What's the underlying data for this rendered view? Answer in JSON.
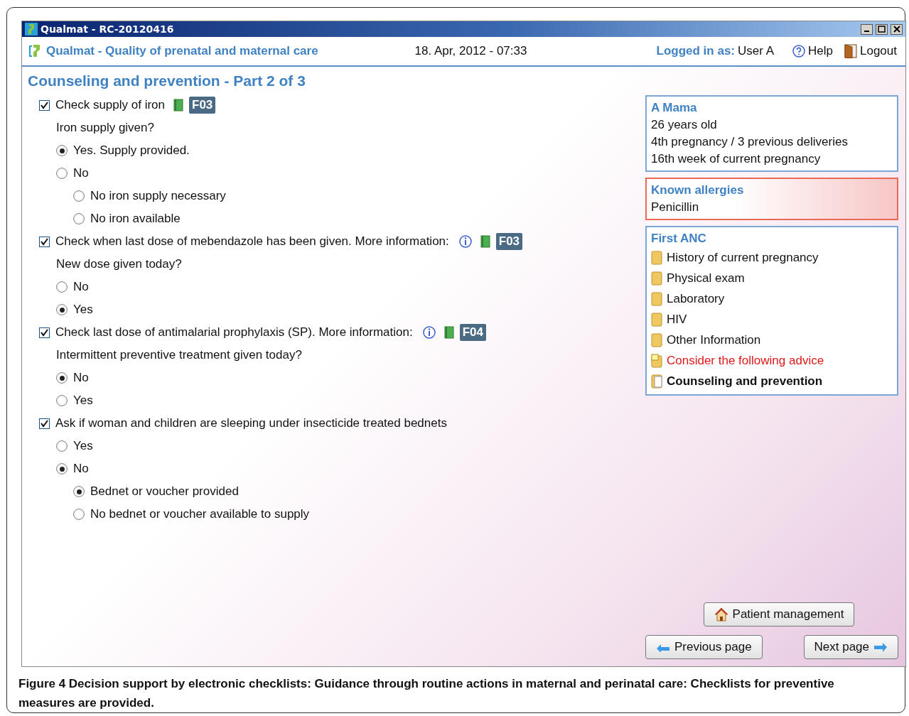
{
  "window": {
    "title": "Qualmat - RC-20120416"
  },
  "header": {
    "app_name": "Qualmat - Quality of prenatal and maternal care",
    "datetime": "18. Apr, 2012 - 07:33",
    "logged_in_label": "Logged in as:",
    "user": "User A",
    "help": "Help",
    "logout": "Logout"
  },
  "page_title": "Counseling and prevention - Part 2 of 3",
  "checklist": [
    {
      "label": "Check supply of iron",
      "checked": true,
      "info": false,
      "reference": "F03",
      "question": "Iron supply given?",
      "options": [
        {
          "label": "Yes. Supply provided.",
          "selected": true
        },
        {
          "label": "No",
          "selected": false,
          "children": [
            {
              "label": "No iron supply necessary",
              "selected": false
            },
            {
              "label": "No iron available",
              "selected": false
            }
          ]
        }
      ]
    },
    {
      "label": "Check when last dose of mebendazole has been given. More information:",
      "checked": true,
      "info": true,
      "reference": "F03",
      "question": "New dose given today?",
      "options": [
        {
          "label": "No",
          "selected": false
        },
        {
          "label": "Yes",
          "selected": true
        }
      ]
    },
    {
      "label": "Check last dose of antimalarial prophylaxis (SP). More information:",
      "checked": true,
      "info": true,
      "reference": "F04",
      "question": "Intermittent preventive treatment given today?",
      "options": [
        {
          "label": "No",
          "selected": true
        },
        {
          "label": "Yes",
          "selected": false
        }
      ]
    },
    {
      "label": "Ask if woman and children are sleeping under insecticide treated bednets",
      "checked": true,
      "info": false,
      "options": [
        {
          "label": "Yes",
          "selected": false
        },
        {
          "label": "No",
          "selected": true,
          "children": [
            {
              "label": "Bednet or voucher provided",
              "selected": true
            },
            {
              "label": "No bednet or voucher available to supply",
              "selected": false
            }
          ]
        }
      ]
    }
  ],
  "patient": {
    "name": "A Mama",
    "details": [
      "26 years old",
      "4th pregnancy / 3 previous deliveries",
      "16th week of current pregnancy"
    ]
  },
  "allergies": {
    "title": "Known allergies",
    "items": [
      "Penicillin"
    ]
  },
  "navigation": {
    "title": "First ANC",
    "items": [
      {
        "label": "History of current pregnancy",
        "kind": "section"
      },
      {
        "label": "Physical exam",
        "kind": "section"
      },
      {
        "label": "Laboratory",
        "kind": "section"
      },
      {
        "label": "HIV",
        "kind": "section"
      },
      {
        "label": "Other Information",
        "kind": "section"
      },
      {
        "label": "Consider the following advice",
        "kind": "advice"
      },
      {
        "label": "Counseling and prevention",
        "kind": "current"
      }
    ]
  },
  "buttons": {
    "patient_management": "Patient management",
    "previous": "Previous page",
    "next": "Next page"
  },
  "caption": "Figure 4 Decision support by electronic checklists: Guidance through routine actions in maternal and perinatal care: Checklists for preventive measures are provided."
}
